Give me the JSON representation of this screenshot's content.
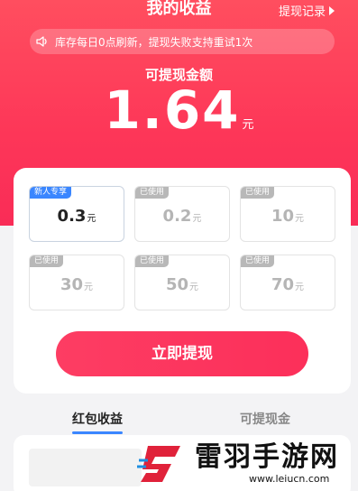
{
  "header": {
    "title": "我的收益",
    "withdraw_record_label": "提现记录"
  },
  "notice": {
    "text": "库存每日0点刷新，提现失败支持重试1次",
    "icon": "speaker-icon"
  },
  "balance": {
    "label": "可提现金额",
    "amount": "1.64",
    "unit": "元"
  },
  "options": [
    {
      "tag": "新人专享",
      "value": "0.3",
      "unit": "元",
      "selected": true
    },
    {
      "tag": "已使用",
      "value": "0.2",
      "unit": "元",
      "selected": false
    },
    {
      "tag": "已使用",
      "value": "10",
      "unit": "元",
      "selected": false
    },
    {
      "tag": "已使用",
      "value": "30",
      "unit": "元",
      "selected": false
    },
    {
      "tag": "已使用",
      "value": "50",
      "unit": "元",
      "selected": false
    },
    {
      "tag": "已使用",
      "value": "70",
      "unit": "元",
      "selected": false
    }
  ],
  "withdraw_button_label": "立即提现",
  "tabs": [
    {
      "label": "红包收益",
      "active": true
    },
    {
      "label": "可提现金",
      "active": false
    }
  ],
  "watermark": {
    "name": "雷羽手游网",
    "url": "www.leiucn.com"
  },
  "colors": {
    "hero": "#fd3658",
    "accent_blue": "#3a86ff",
    "button": "#fc2f5a"
  }
}
